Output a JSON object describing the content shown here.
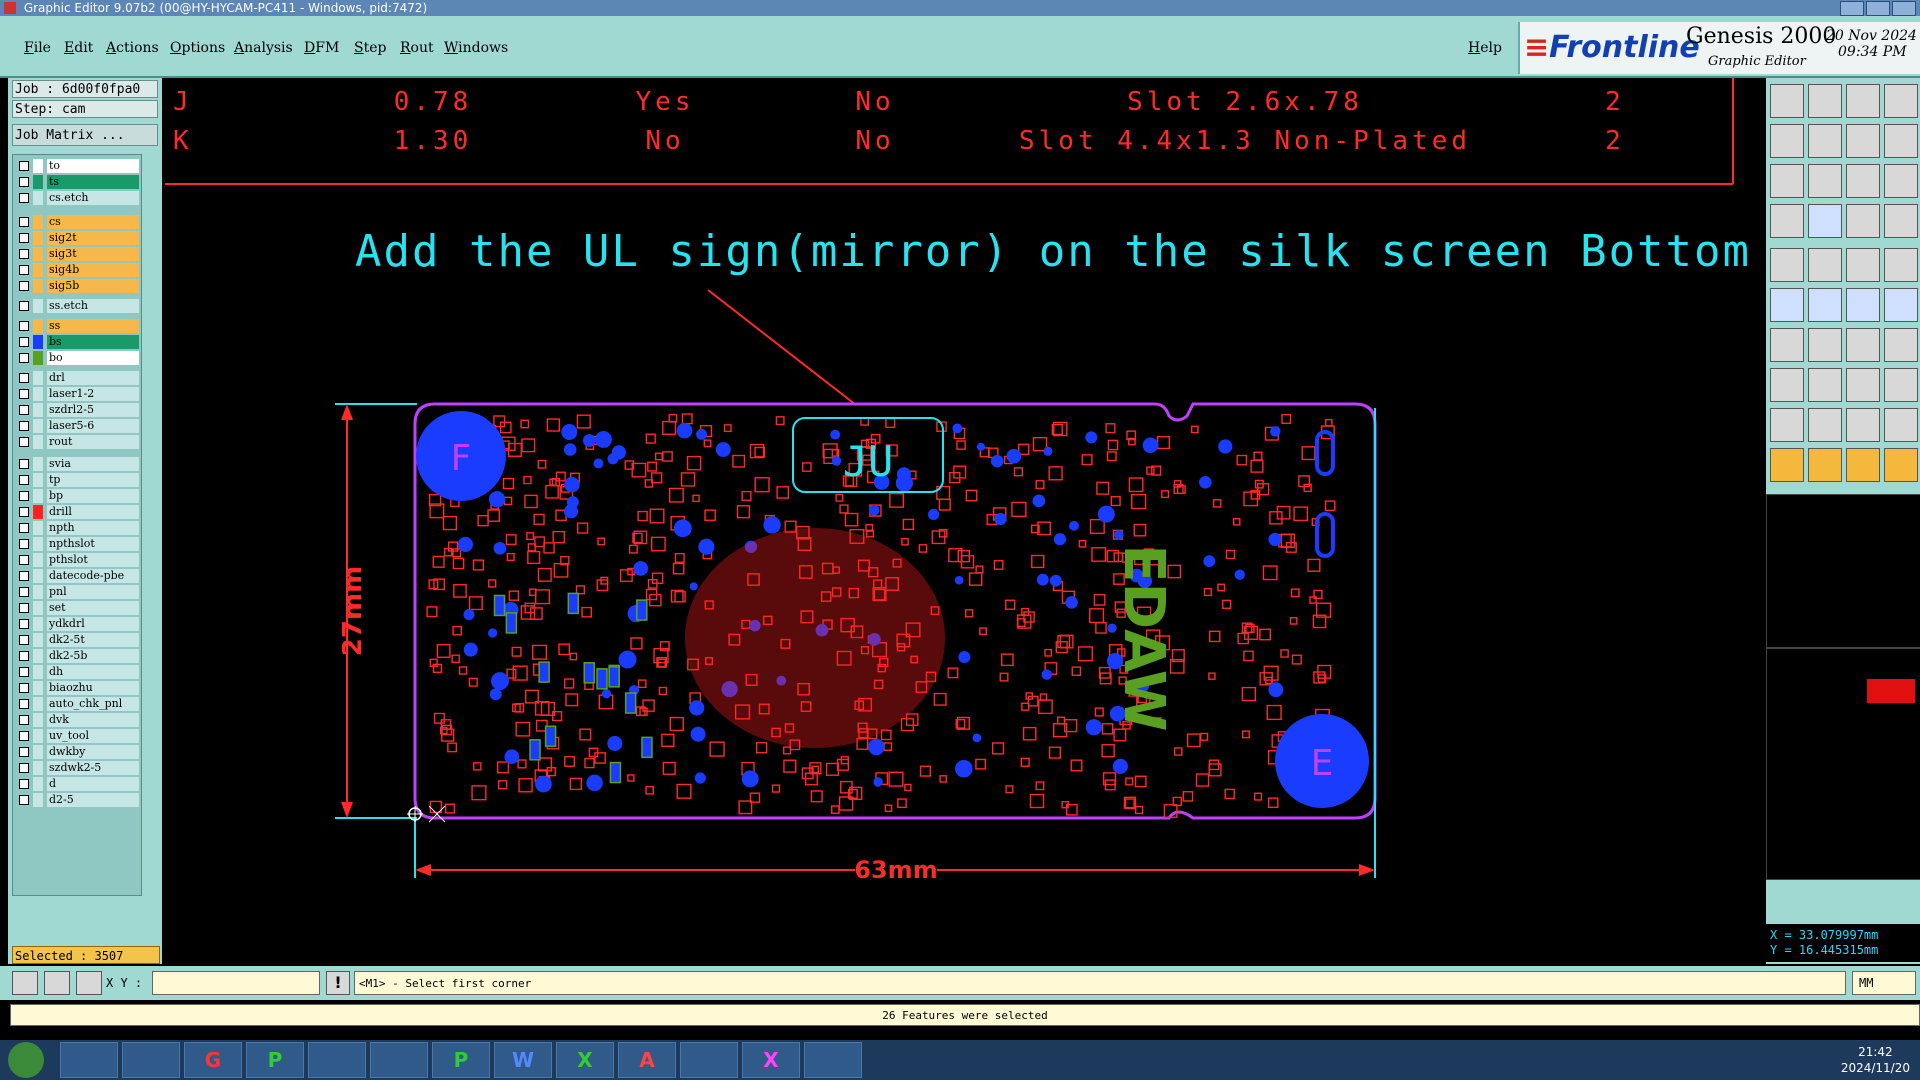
{
  "window": {
    "title": "Graphic Editor 9.07b2 (00@HY-HYCAM-PC411 - Windows, pid:7472)"
  },
  "menu": {
    "items": [
      "File",
      "Edit",
      "Actions",
      "Options",
      "Analysis",
      "DFM",
      "Step",
      "Rout",
      "Windows"
    ],
    "help": "Help"
  },
  "brand": {
    "logo": "Frontline",
    "product": "Genesis 2000",
    "subtitle": "Graphic Editor",
    "date": "20 Nov 2024",
    "time": "09:34 PM"
  },
  "job": {
    "job": "Job : 6d00f0fpa0",
    "step": "Step: cam",
    "matrix_button": "Job Matrix ..."
  },
  "layers": [
    {
      "name": "to",
      "swatch": "#ffffff",
      "bg": "#ffffff"
    },
    {
      "name": "ts",
      "swatch": "#1a9a6a",
      "bg": "#1a9a6a"
    },
    {
      "name": "cs.etch",
      "swatch": "#c6e6e6",
      "bg": "#c6e6e6"
    },
    {
      "name": "cs",
      "swatch": "#f6b84a",
      "bg": "#f6b84a"
    },
    {
      "name": "sig2t",
      "swatch": "#f6b84a",
      "bg": "#f6b84a"
    },
    {
      "name": "sig3t",
      "swatch": "#f6b84a",
      "bg": "#f6b84a"
    },
    {
      "name": "sig4b",
      "swatch": "#f6b84a",
      "bg": "#f6b84a"
    },
    {
      "name": "sig5b",
      "swatch": "#f6b84a",
      "bg": "#f6b84a"
    },
    {
      "name": "ss.etch",
      "swatch": "#c6e6e6",
      "bg": "#c6e6e6"
    },
    {
      "name": "ss",
      "swatch": "#f6b84a",
      "bg": "#f6b84a"
    },
    {
      "name": "bs",
      "swatch": "#1a3cff",
      "bg": "#1a9a6a"
    },
    {
      "name": "bo",
      "swatch": "#5aa020",
      "bg": "#ffffff"
    },
    {
      "name": "drl",
      "swatch": "#c6e6e6",
      "bg": "#c6e6e6"
    },
    {
      "name": "laser1-2",
      "swatch": "#c6e6e6",
      "bg": "#c6e6e6"
    },
    {
      "name": "szdrl2-5",
      "swatch": "#c6e6e6",
      "bg": "#c6e6e6"
    },
    {
      "name": "laser5-6",
      "swatch": "#c6e6e6",
      "bg": "#c6e6e6"
    },
    {
      "name": "rout",
      "swatch": "#c6e6e6",
      "bg": "#c6e6e6"
    },
    {
      "name": "svia",
      "swatch": "#c6e6e6",
      "bg": "#c6e6e6"
    },
    {
      "name": "tp",
      "swatch": "#c6e6e6",
      "bg": "#c6e6e6"
    },
    {
      "name": "bp",
      "swatch": "#c6e6e6",
      "bg": "#c6e6e6"
    },
    {
      "name": "drill",
      "swatch": "#ff2020",
      "bg": "#c6e6e6"
    },
    {
      "name": "npth",
      "swatch": "#c6e6e6",
      "bg": "#c6e6e6"
    },
    {
      "name": "npthslot",
      "swatch": "#c6e6e6",
      "bg": "#c6e6e6"
    },
    {
      "name": "pthslot",
      "swatch": "#c6e6e6",
      "bg": "#c6e6e6"
    },
    {
      "name": "datecode-pbe",
      "swatch": "#c6e6e6",
      "bg": "#c6e6e6"
    },
    {
      "name": "pnl",
      "swatch": "#c6e6e6",
      "bg": "#c6e6e6"
    },
    {
      "name": "set",
      "swatch": "#c6e6e6",
      "bg": "#c6e6e6"
    },
    {
      "name": "ydkdrl",
      "swatch": "#c6e6e6",
      "bg": "#c6e6e6"
    },
    {
      "name": "dk2-5t",
      "swatch": "#c6e6e6",
      "bg": "#c6e6e6"
    },
    {
      "name": "dk2-5b",
      "swatch": "#c6e6e6",
      "bg": "#c6e6e6"
    },
    {
      "name": "dh",
      "swatch": "#c6e6e6",
      "bg": "#c6e6e6"
    },
    {
      "name": "biaozhu",
      "swatch": "#c6e6e6",
      "bg": "#c6e6e6"
    },
    {
      "name": "auto_chk_pnl",
      "swatch": "#c6e6e6",
      "bg": "#c6e6e6"
    },
    {
      "name": "dvk",
      "swatch": "#c6e6e6",
      "bg": "#c6e6e6"
    },
    {
      "name": "uv_tool",
      "swatch": "#c6e6e6",
      "bg": "#c6e6e6"
    },
    {
      "name": "dwkby",
      "swatch": "#c6e6e6",
      "bg": "#c6e6e6"
    },
    {
      "name": "szdwk2-5",
      "swatch": "#c6e6e6",
      "bg": "#c6e6e6"
    },
    {
      "name": "d",
      "swatch": "#c6e6e6",
      "bg": "#c6e6e6"
    },
    {
      "name": "d2-5",
      "swatch": "#c6e6e6",
      "bg": "#c6e6e6"
    }
  ],
  "selected": "Selected : 3507",
  "drill_table": [
    {
      "id": "J",
      "size": "0.78",
      "plated": "Yes",
      "via": "No",
      "desc": "Slot 2.6x.78",
      "count": "2"
    },
    {
      "id": "K",
      "size": "1.30",
      "plated": "No",
      "via": "No",
      "desc": "Slot 4.4x1.3 Non-Plated",
      "count": "2"
    }
  ],
  "annotation": "Add the UL sign(mirror) on the silk screen Bottom",
  "board": {
    "width_label": "63mm",
    "height_label": "27mm",
    "ul_mark": "JU",
    "fiducial_f": "F",
    "fiducial_e": "E",
    "brand_text": "EDAW"
  },
  "coords": {
    "x": "X = 33.079997mm",
    "y": "Y = 16.445315mm"
  },
  "command": {
    "xy_label": "X Y :",
    "prompt": "<M1> - Select first corner",
    "units": "MM"
  },
  "status": "26 Features were selected",
  "taskbar": {
    "time": "21:42",
    "date": "2024/11/20"
  },
  "colors": {
    "accent": "#9fd9d2",
    "drill": "#ff2a2a",
    "annotation": "#25e3f0",
    "outline": "#c040ff",
    "pad": "#1a3cff"
  }
}
